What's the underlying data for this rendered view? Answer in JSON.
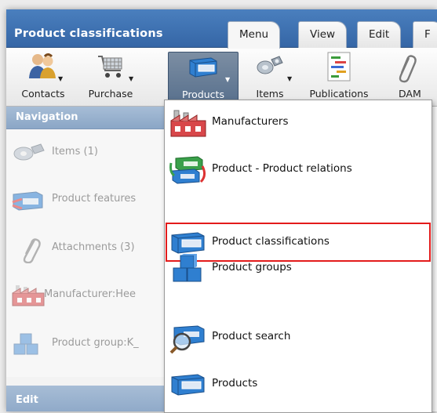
{
  "app": {
    "title": "Product classifications"
  },
  "tabs": [
    {
      "label": "Menu",
      "active": true
    },
    {
      "label": "View",
      "active": false
    },
    {
      "label": "Edit",
      "active": false
    },
    {
      "label": "F",
      "active": false
    }
  ],
  "ribbon": {
    "buttons": [
      {
        "label": "Contacts",
        "icon": "contacts-icon"
      },
      {
        "label": "Purchase",
        "icon": "shopping-cart-icon"
      },
      {
        "label": "Products",
        "icon": "product-box-icon",
        "active": true
      },
      {
        "label": "Items",
        "icon": "items-icon"
      },
      {
        "label": "Publications",
        "icon": "publications-icon"
      },
      {
        "label": "DAM",
        "icon": "paperclip-icon"
      }
    ]
  },
  "navigation": {
    "title": "Navigation",
    "items": [
      {
        "label": "Items (1)",
        "icon": "items-icon"
      },
      {
        "label": "Product features",
        "icon": "product-features-icon"
      },
      {
        "label": "Attachments (3)",
        "icon": "paperclip-icon"
      },
      {
        "label": "Manufacturer:Hee",
        "icon": "factory-icon"
      },
      {
        "label": "Product group:K_",
        "icon": "cubes-icon"
      }
    ]
  },
  "edit_panel": {
    "title": "Edit"
  },
  "dropdown": {
    "items": [
      {
        "label": "Manufacturers",
        "icon": "factory-icon"
      },
      {
        "label": "Product - Product relations",
        "icon": "relations-icon"
      },
      {
        "label": "Product classifications",
        "icon": "product-box-icon",
        "highlighted": true
      },
      {
        "label": "Product groups",
        "icon": "cubes-icon"
      },
      {
        "label": "Product search",
        "icon": "search-icon"
      },
      {
        "label": "Products",
        "icon": "product-box-icon"
      }
    ]
  },
  "colors": {
    "title_bar": "#3f73b3",
    "highlight_outline": "#e31b1b",
    "panel_header": "#9bb3cf",
    "active_ribbon": "#667d99"
  }
}
